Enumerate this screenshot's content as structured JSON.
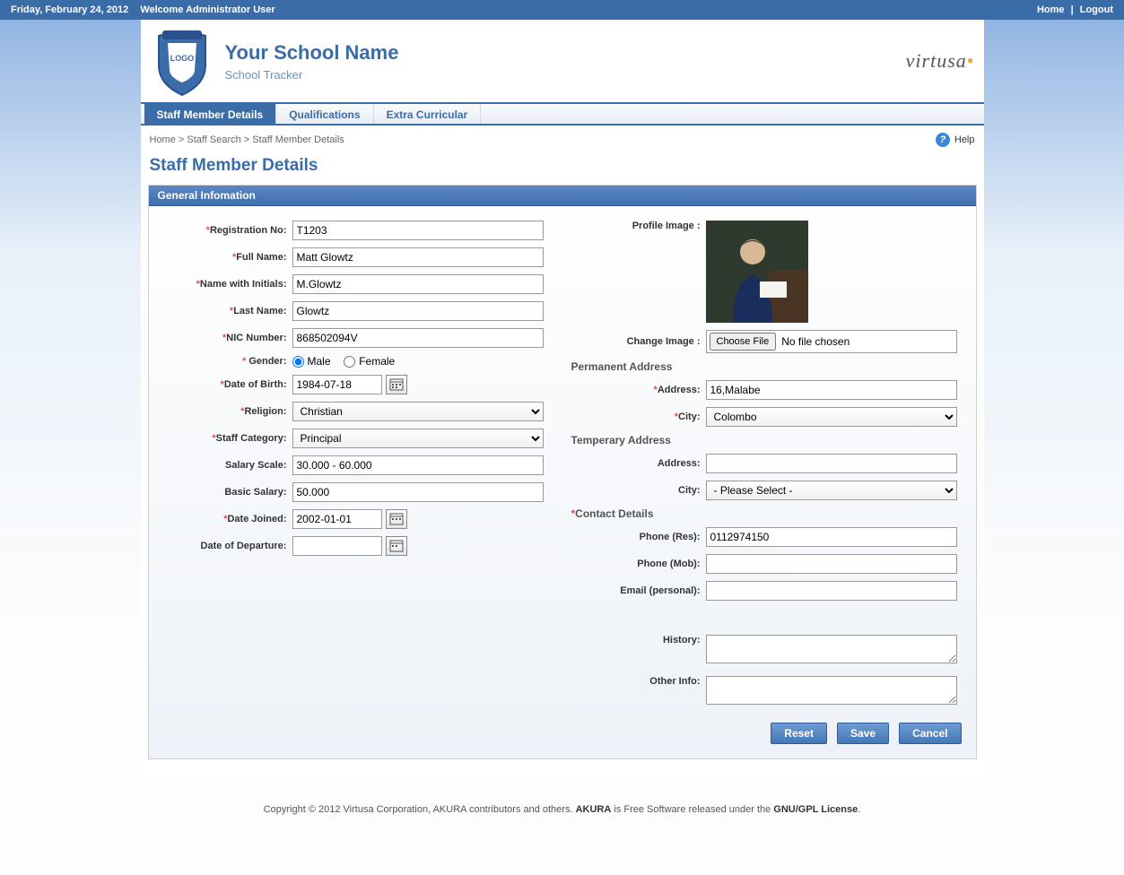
{
  "topbar": {
    "date": "Friday, February 24, 2012",
    "welcome": "Welcome Administrator User",
    "home": "Home",
    "logout": "Logout"
  },
  "header": {
    "logo_text": "LOGO",
    "title": "Your School Name",
    "subtitle": "School Tracker",
    "brand": "virtusa"
  },
  "tabs": {
    "t0": "Staff Member Details",
    "t1": "Qualifications",
    "t2": "Extra Curricular"
  },
  "breadcrumb": {
    "home": "Home",
    "search": "Staff Search",
    "current": "Staff Member Details",
    "help": "Help"
  },
  "page_title": "Staff Member Details",
  "panel_title": "General Infomation",
  "labels": {
    "reg_no": "Registration No:",
    "full_name": "Full Name:",
    "name_initials": "Name with Initials:",
    "last_name": "Last Name:",
    "nic": "NIC Number:",
    "gender": "Gender:",
    "male": "Male",
    "female": "Female",
    "dob": "Date of Birth:",
    "religion": "Religion:",
    "staff_cat": "Staff Category:",
    "salary_scale": "Salary Scale:",
    "basic_salary": "Basic Salary:",
    "date_joined": "Date Joined:",
    "date_departure": "Date of Departure:",
    "profile_image": "Profile Image :",
    "change_image": "Change Image :",
    "choose_file": "Choose File",
    "no_file": "No file chosen",
    "perm_addr": "Permanent Address",
    "address": "Address:",
    "city": "City:",
    "temp_addr": "Temperary Address",
    "contact": "Contact Details",
    "phone_res": "Phone (Res):",
    "phone_mob": "Phone (Mob):",
    "email": "Email (personal):",
    "history": "History:",
    "other": "Other Info:"
  },
  "values": {
    "reg_no": "T1203",
    "full_name": "Matt Glowtz",
    "name_initials": "M.Glowtz",
    "last_name": "Glowtz",
    "nic": "868502094V",
    "gender": "Male",
    "dob": "1984-07-18",
    "religion": "Christian",
    "staff_cat": "Principal",
    "salary_scale": "30.000 - 60.000",
    "basic_salary": "50.000",
    "date_joined": "2002-01-01",
    "date_departure": "",
    "perm_address": "16,Malabe",
    "perm_city": "Colombo",
    "temp_address": "",
    "temp_city": "- Please Select -",
    "phone_res": "0112974150",
    "phone_mob": "",
    "email": "",
    "history": "",
    "other": ""
  },
  "buttons": {
    "reset": "Reset",
    "save": "Save",
    "cancel": "Cancel"
  },
  "footer": {
    "pre": "Copyright © 2012 Virtusa Corporation, AKURA contributors and others. ",
    "prod": "AKURA",
    "mid": " is Free Software released under the ",
    "lic": "GNU/GPL License",
    "end": "."
  }
}
